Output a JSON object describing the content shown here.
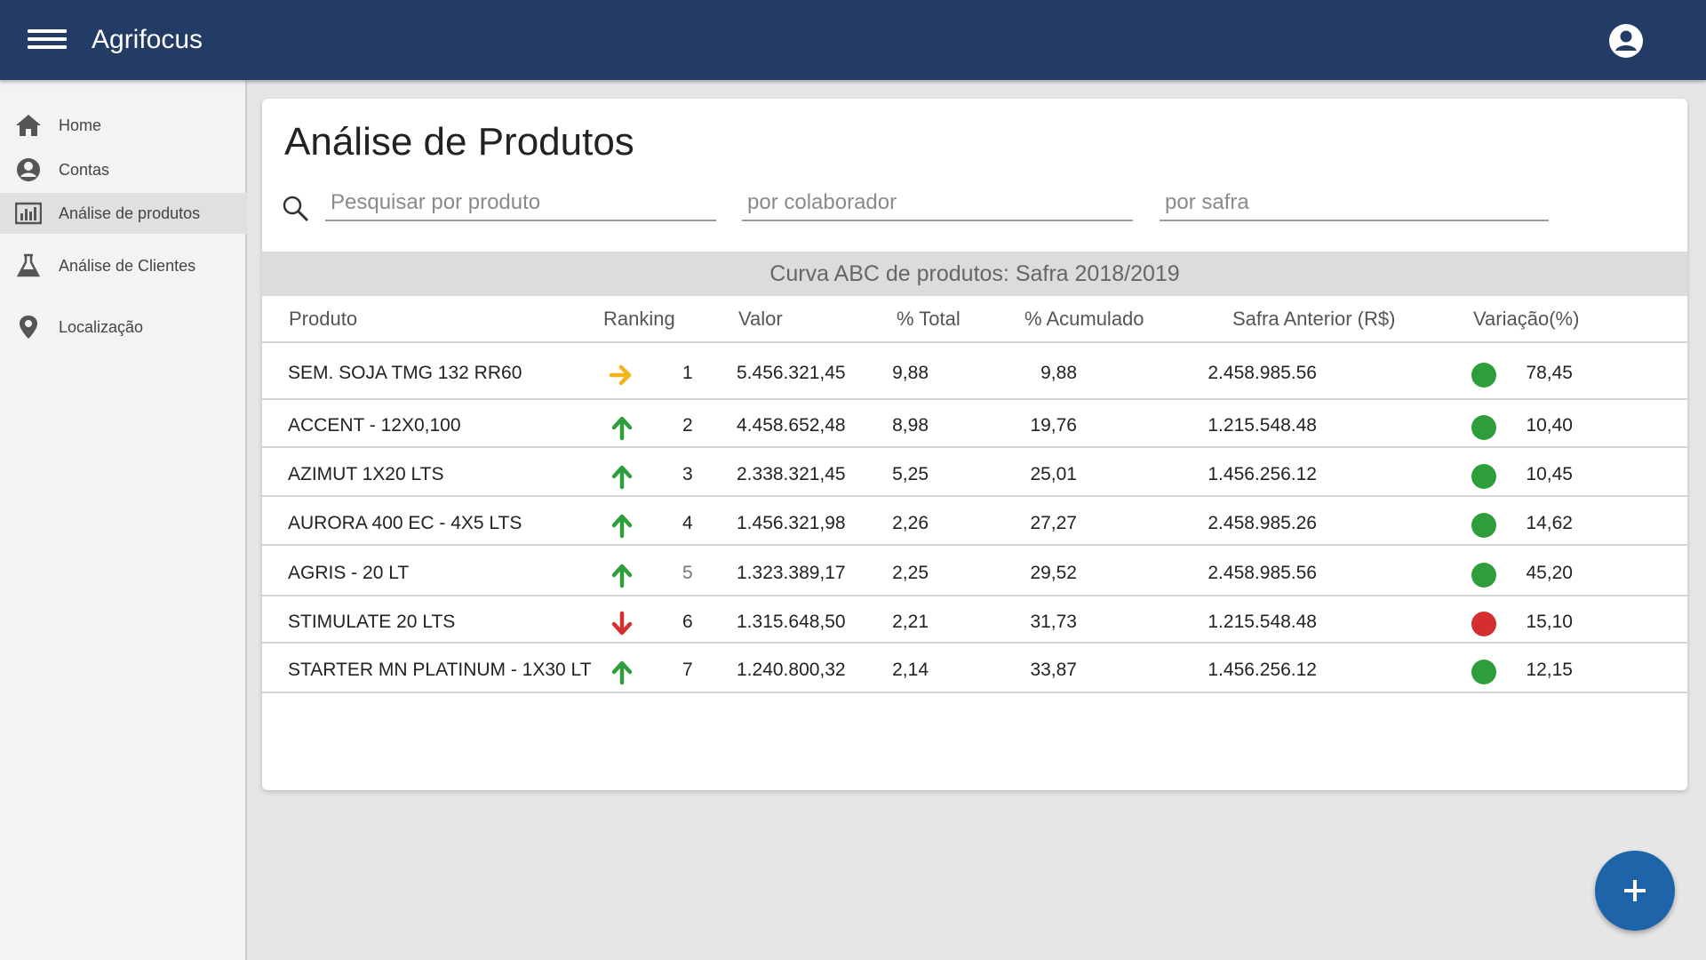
{
  "app": {
    "title": "Agrifocus"
  },
  "sidebar": {
    "items": [
      {
        "label": "Home",
        "icon": "home-icon"
      },
      {
        "label": "Contas",
        "icon": "account-circle-icon"
      },
      {
        "label": "Análise de produtos",
        "icon": "bar-chart-icon",
        "active": true
      },
      {
        "label": "Análise de Clientes",
        "icon": "flask-icon"
      },
      {
        "label": "Localização",
        "icon": "map-pin-icon"
      }
    ]
  },
  "page": {
    "title": "Análise de Produtos"
  },
  "filters": {
    "product_placeholder": "Pesquisar por produto",
    "collaborator_placeholder": "por colaborador",
    "harvest_placeholder": "por safra"
  },
  "table": {
    "caption": "Curva ABC de produtos: Safra 2018/2019",
    "headers": [
      "Produto",
      "Ranking",
      "Valor",
      "% Total",
      "% Acumulado",
      "Safra Anterior (R$)",
      "Variação(%)"
    ],
    "rows": [
      {
        "produto": "SEM. SOJA TMG 132 RR60",
        "trend": "right",
        "ranking": "1",
        "valor": "5.456.321,45",
        "total": "9,88",
        "acumulado": "9,88",
        "anterior": "2.458.985.56",
        "status": "positive",
        "variacao": "78,45"
      },
      {
        "produto": "ACCENT - 12X0,100",
        "trend": "up",
        "ranking": "2",
        "valor": "4.458.652,48",
        "total": "8,98",
        "acumulado": "19,76",
        "anterior": "1.215.548.48",
        "status": "positive",
        "variacao": "10,40"
      },
      {
        "produto": "AZIMUT 1X20 LTS",
        "trend": "up",
        "ranking": "3",
        "valor": "2.338.321,45",
        "total": "5,25",
        "acumulado": "25,01",
        "anterior": "1.456.256.12",
        "status": "positive",
        "variacao": "10,45"
      },
      {
        "produto": "AURORA 400 EC - 4X5 LTS",
        "trend": "up",
        "ranking": "4",
        "valor": "1.456.321,98",
        "total": "2,26",
        "acumulado": "27,27",
        "anterior": "2.458.985.26",
        "status": "positive",
        "variacao": "14,62"
      },
      {
        "produto": "AGRIS - 20 LT",
        "trend": "up",
        "ranking": "5",
        "valor": "1.323.389,17",
        "total": "2,25",
        "acumulado": "29,52",
        "anterior": "2.458.985.56",
        "status": "positive",
        "variacao": "45,20"
      },
      {
        "produto": "STIMULATE 20 LTS",
        "trend": "down",
        "ranking": "6",
        "valor": "1.315.648,50",
        "total": "2,21",
        "acumulado": "31,73",
        "anterior": "1.215.548.48",
        "status": "negative",
        "variacao": "15,10"
      },
      {
        "produto": "STARTER MN PLATINUM - 1X30 LT",
        "trend": "up",
        "ranking": "7",
        "valor": "1.240.800,32",
        "total": "2,14",
        "acumulado": "33,87",
        "anterior": "1.456.256.12",
        "status": "positive",
        "variacao": "12,15"
      }
    ]
  },
  "colors": {
    "topbar": "#233c66",
    "trend_up": "#2e9e3a",
    "trend_down": "#d32f2f",
    "trend_neutral": "#f2b41c",
    "status_positive": "#2e9e3a",
    "status_negative": "#d32f2f",
    "fab": "#1d64a8"
  },
  "fab": {
    "icon": "plus-icon"
  }
}
